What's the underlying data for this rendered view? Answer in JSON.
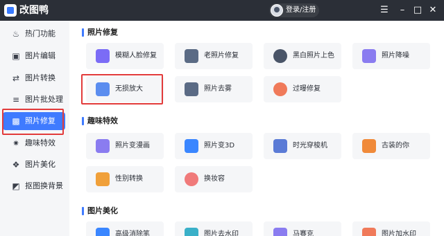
{
  "app": {
    "title": "改图鸭",
    "login_label": "登录/注册"
  },
  "window_controls": {
    "menu": "☰",
    "minimize": "–",
    "maximize": "□",
    "close": "✕"
  },
  "sidebar": {
    "items": [
      {
        "label": "热门功能",
        "icon": "flame-icon",
        "glyph": "♨"
      },
      {
        "label": "图片编辑",
        "icon": "image-edit-icon",
        "glyph": "▣"
      },
      {
        "label": "图片转换",
        "icon": "convert-icon",
        "glyph": "⇄"
      },
      {
        "label": "图片批处理",
        "icon": "batch-icon",
        "glyph": "≡"
      },
      {
        "label": "照片修复",
        "icon": "photo-repair-icon",
        "glyph": "▩"
      },
      {
        "label": "趣味特效",
        "icon": "sparkle-icon",
        "glyph": "✷"
      },
      {
        "label": "图片美化",
        "icon": "beautify-icon",
        "glyph": "❖"
      },
      {
        "label": "抠图换背景",
        "icon": "cutout-icon",
        "glyph": "◩"
      }
    ],
    "active_index": 4
  },
  "sections": [
    {
      "title": "照片修复",
      "cards": [
        {
          "label": "模糊人脸修复",
          "icon": "face-repair-icon",
          "color": "#7b6cf6"
        },
        {
          "label": "老照片修复",
          "icon": "old-photo-icon",
          "color": "#5b6b85"
        },
        {
          "label": "黑白照片上色",
          "icon": "palette-icon",
          "color": "#4a5568"
        },
        {
          "label": "照片降噪",
          "icon": "denoise-icon",
          "color": "#8a7cf0"
        },
        {
          "label": "无损放大",
          "icon": "upscale-icon",
          "color": "#5b8def"
        },
        {
          "label": "照片去雾",
          "icon": "dehaze-icon",
          "color": "#5b6b85"
        },
        {
          "label": "过曝修复",
          "icon": "overexposure-icon",
          "color": "#f07a5a"
        }
      ]
    },
    {
      "title": "趣味特效",
      "cards": [
        {
          "label": "照片变漫画",
          "icon": "comic-icon",
          "color": "#8a7cf0"
        },
        {
          "label": "照片变3D",
          "icon": "cube-icon",
          "color": "#3a86ff"
        },
        {
          "label": "时光穿梭机",
          "icon": "time-machine-icon",
          "color": "#5b7bd6"
        },
        {
          "label": "古装的你",
          "icon": "ancient-costume-icon",
          "color": "#f08a3a"
        },
        {
          "label": "性别转换",
          "icon": "gender-swap-icon",
          "color": "#f0a03a"
        },
        {
          "label": "换妆容",
          "icon": "makeup-icon",
          "color": "#f07a7a"
        }
      ]
    },
    {
      "title": "图片美化",
      "cards": [
        {
          "label": "高级消除笔",
          "icon": "eraser-icon",
          "color": "#3a86ff"
        },
        {
          "label": "图片去水印",
          "icon": "watermark-remove-icon",
          "color": "#3ab0c8"
        },
        {
          "label": "马赛克",
          "icon": "mosaic-icon",
          "color": "#8a7cf0"
        },
        {
          "label": "图片加水印",
          "icon": "watermark-add-icon",
          "color": "#f07a5a"
        }
      ]
    }
  ],
  "colors": {
    "titlebar": "#2b2f37",
    "accent": "#3f7bff",
    "highlight_box": "#e23a3a"
  }
}
